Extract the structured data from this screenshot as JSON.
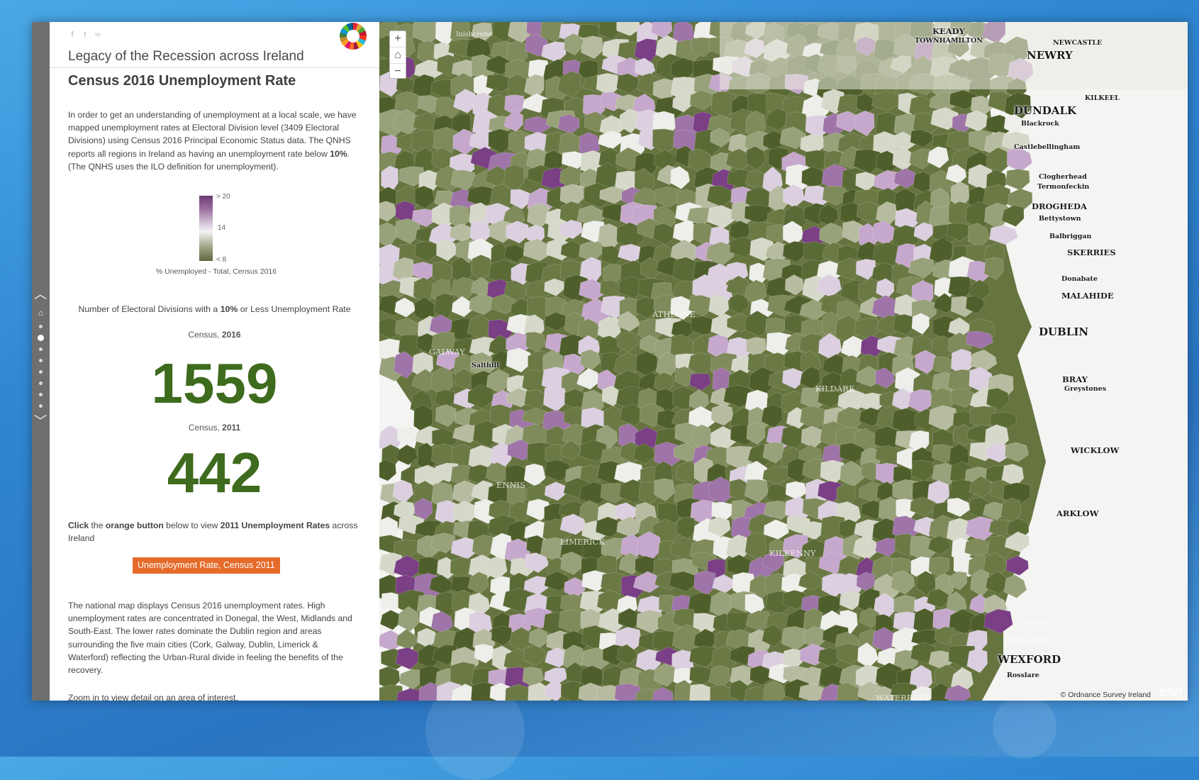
{
  "panel": {
    "story_title": "Legacy of the Recession across Ireland",
    "section_title": "Census 2016 Unemployment Rate",
    "intro_part1": "In order to get an understanding of unemployment at a local scale, we have mapped unemployment rates at Electoral Division level (3409 Electoral Divisions) using Census 2016 Principal Economic Status data. The QNHS reports all regions in Ireland as having an unemployment rate below ",
    "intro_bold": "10%",
    "intro_part2": ". (The QNHS uses the ILO definition for unemployment).",
    "legend": {
      "high": "> 20",
      "mid": "14",
      "low": "< 8",
      "caption": "% Unemployed - Total, Census 2016",
      "ramp_colors": [
        "#6d3a72",
        "#dccfe0",
        "#f2f2f2",
        "#5e6840"
      ]
    },
    "metric_title_part1": "Number of Electoral Divisions with a ",
    "metric_title_bold": "10%",
    "metric_title_part2": " or Less Unemployment Rate",
    "census_2016": {
      "label_prefix": "Census, ",
      "year": "2016",
      "value": "1559"
    },
    "census_2011": {
      "label_prefix": "Census, ",
      "year": "2011",
      "value": "442"
    },
    "click_note": {
      "bold1": "Click",
      "text1": " the ",
      "bold2": "orange button",
      "text2": " below to view ",
      "bold3": "2011 Unemployment Rates",
      "text3": " across Ireland"
    },
    "button_label": "Unemployment Rate, Census 2011",
    "outro": "The national map displays Census 2016 unemployment rates. High unemployment rates are concentrated in Donegal, the West, Midlands and South-East. The lower rates dominate the Dublin region and areas surrounding the five main cities (Cork, Galway, Dublin, Limerick & Waterford) reflecting the Urban-Rural divide in feeling the benefits of the recovery.",
    "zoom_note": "Zoom in to view detail on an area of interest."
  },
  "map": {
    "controls": {
      "zoom_in": "+",
      "home": "⌂",
      "zoom_out": "−"
    },
    "places": {
      "newry": "NEWRY",
      "keady": "KEADY",
      "townhamilton": "TOWNHAMILTON",
      "newcastle": "NEWCASTLE",
      "kilkeel": "KILKEEL",
      "dundalk": "DUNDALK",
      "blackrock": "Blackrock",
      "castlebellingham": "Castlebellingham",
      "clogherhead": "Clogherhead",
      "termonfeckin": "Termonfeckin",
      "drogheda": "DROGHEDA",
      "bettystown": "Bettystown",
      "balbriggan": "Balbriggan",
      "skerries": "SKERRIES",
      "donabate": "Donabate",
      "malahide": "MALAHIDE",
      "dublin": "DUBLIN",
      "bray": "BRAY",
      "greystones": "Greystones",
      "wicklow": "WICKLOW",
      "arklow": "ARKLOW",
      "wexford": "WEXFORD",
      "rosslare": "Rosslare",
      "courtown": "Courtown",
      "enniscorthy": "Enniscorthy",
      "galway": "GALWAY",
      "salthill": "Salthill",
      "athlone": "ATHLONE",
      "limerick": "LIMERICK",
      "ennis": "ENNIS",
      "kildare": "KILDARE",
      "kilkenny": "KILKENNY",
      "waterford": "WATERFORD",
      "inishcrone": "Inishcrone"
    },
    "copyright": "© Ordnance Survey Ireland",
    "logo": "esri"
  },
  "nav": {
    "up": "︿",
    "down": "﹀",
    "home": "⌂"
  }
}
